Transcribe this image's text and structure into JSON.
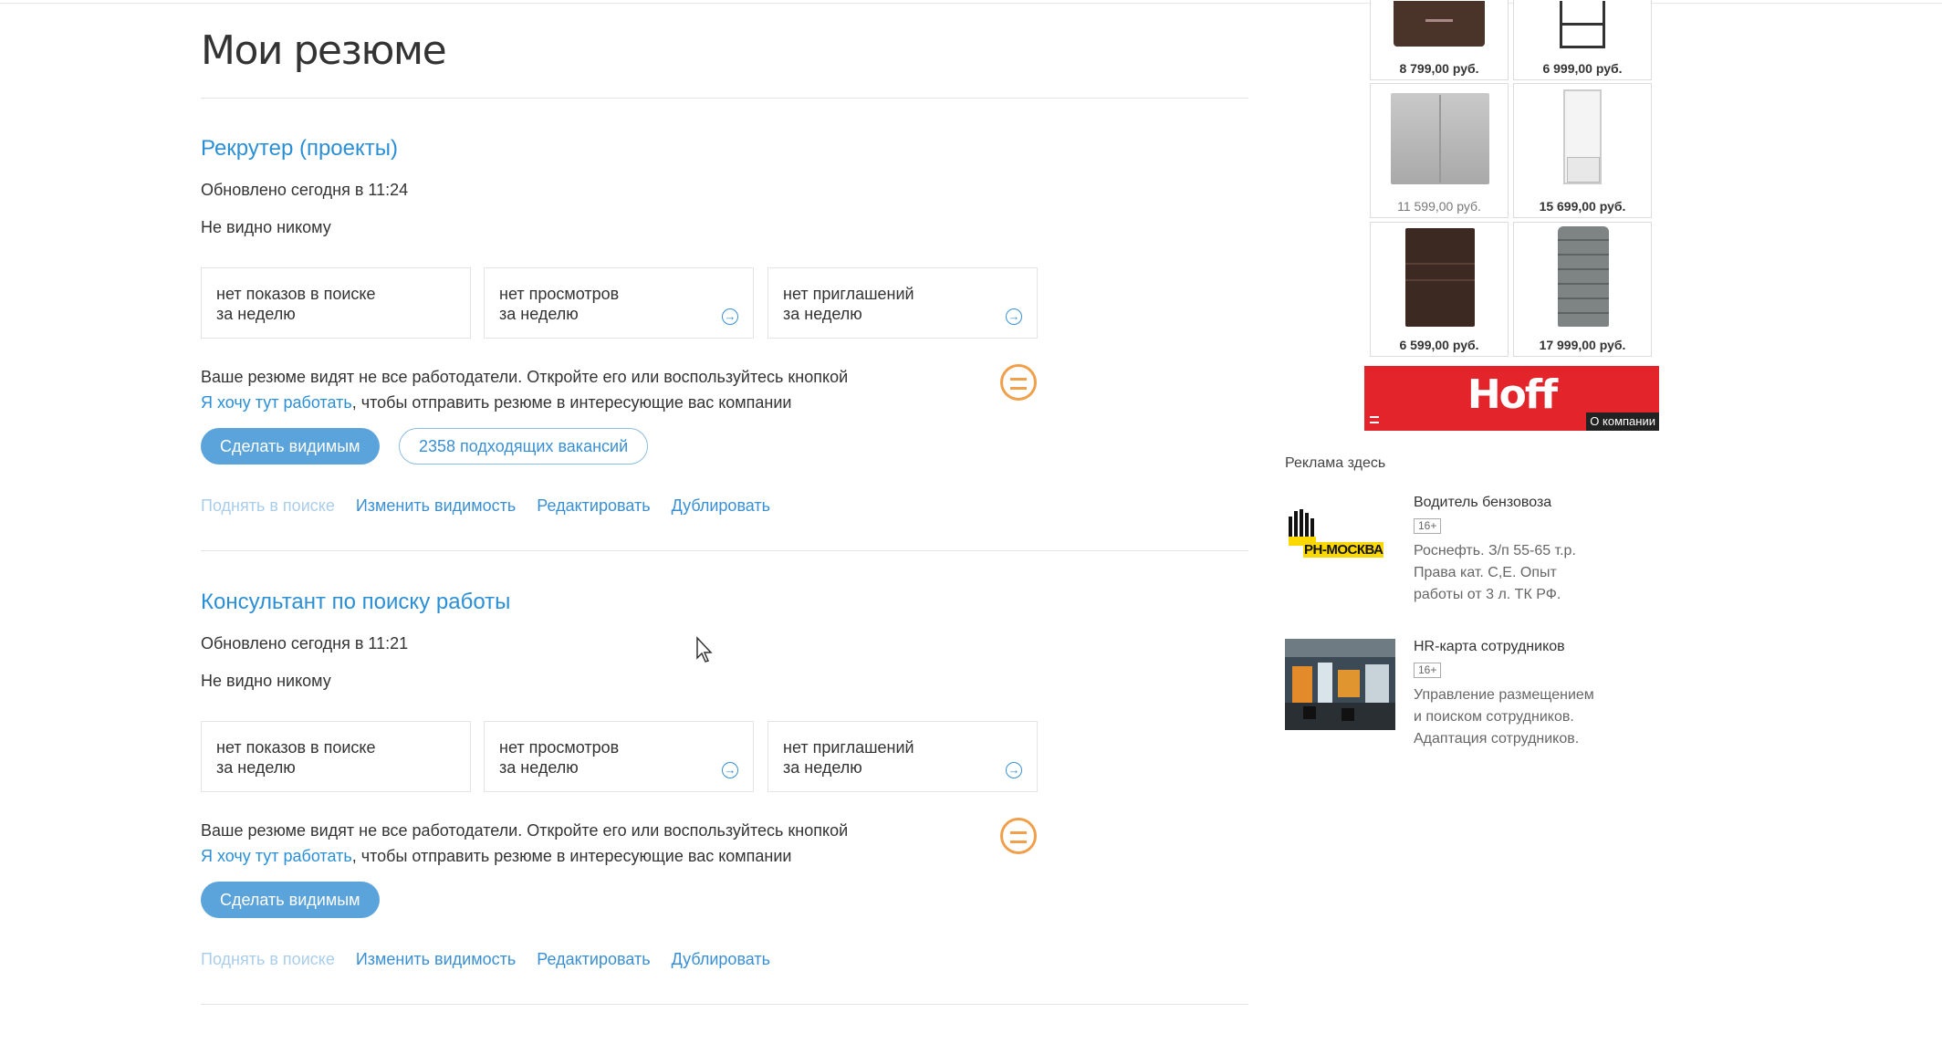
{
  "page": {
    "title": "Мои резюме"
  },
  "resumes": [
    {
      "title": "Рекрутер (проекты)",
      "updated": "Обновлено сегодня в 11:24",
      "visibility": "Не видно никому",
      "stats": [
        {
          "line1": "нет показов в поиске",
          "line2": "за неделю"
        },
        {
          "line1": "нет просмотров",
          "line2": "за неделю"
        },
        {
          "line1": "нет приглашений",
          "line2": "за неделю"
        }
      ],
      "notice_text": "Ваше резюме видят не все работодатели. Откройте его или воспользуйтесь кнопкой",
      "notice_link": "Я хочу тут работать",
      "notice_tail": ", чтобы отправить резюме в интересующие вас компании",
      "primary_button": "Сделать видимым",
      "secondary_button": "2358 подходящих вакансий",
      "actions": [
        "Поднять в поиске",
        "Изменить видимость",
        "Редактировать",
        "Дублировать"
      ]
    },
    {
      "title": "Консультант по поиску работы",
      "updated": "Обновлено сегодня в 11:21",
      "visibility": "Не видно никому",
      "stats": [
        {
          "line1": "нет показов в поиске",
          "line2": "за неделю"
        },
        {
          "line1": "нет просмотров",
          "line2": "за неделю"
        },
        {
          "line1": "нет приглашений",
          "line2": "за неделю"
        }
      ],
      "notice_text": "Ваше резюме видят не все работодатели. Откройте его или воспользуйтесь кнопкой",
      "notice_link": "Я хочу тут работать",
      "notice_tail": ", чтобы отправить резюме в интересующие вас компании",
      "primary_button": "Сделать видимым",
      "actions": [
        "Поднять в поиске",
        "Изменить видимость",
        "Редактировать",
        "Дублировать"
      ]
    }
  ],
  "product_ad": {
    "products": [
      {
        "price": "8 799,00 руб."
      },
      {
        "price": "6 999,00 руб."
      },
      {
        "price": "11 599,00 руб."
      },
      {
        "price": "15 699,00 руб."
      },
      {
        "price": "6 599,00 руб."
      },
      {
        "price": "17 999,00 руб."
      }
    ],
    "brand": "Hoff",
    "about": "О компании"
  },
  "text_ads": {
    "label": "Реклама здесь",
    "items": [
      {
        "logo_text": "РН-МОСКВА",
        "title": "Водитель бензовоза",
        "age": "16+",
        "description": "Роснефть. З/п 55-65 т.р. Права кат. С,Е. Опыт работы от 3 л. ТК РФ."
      },
      {
        "title": "HR-карта сотрудников",
        "age": "16+",
        "description": "Управление размещением и поиском сотрудников. Адаптация сотрудников."
      }
    ]
  }
}
